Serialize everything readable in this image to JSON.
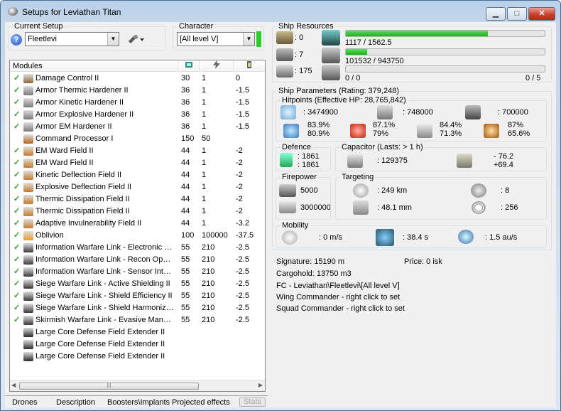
{
  "window": {
    "title": "Setups for Leviathan Titan",
    "controls": {
      "minimize": "▁",
      "maximize": "□",
      "close": "✕"
    }
  },
  "current_setup": {
    "label": "Current Setup",
    "value": "Fleetlevi",
    "help_icon": "?"
  },
  "character": {
    "label": "Character",
    "value": "[All level V]"
  },
  "modules": {
    "headers": {
      "name": "Modules",
      "col1_icon": "cpu-icon",
      "col2_icon": "powergrid-icon",
      "col3_icon": "capacitor-icon"
    },
    "rows": [
      {
        "checked": "✓",
        "name": "Damage Control II",
        "c1": "30",
        "c2": "1",
        "c3": "0",
        "icon_color": "#8a6a3a"
      },
      {
        "checked": "✓",
        "name": "Armor Thermic Hardener II",
        "c1": "36",
        "c2": "1",
        "c3": "-1.5",
        "icon_color": "#7a7a7a"
      },
      {
        "checked": "✓",
        "name": "Armor Kinetic Hardener II",
        "c1": "36",
        "c2": "1",
        "c3": "-1.5",
        "icon_color": "#7a7a7a"
      },
      {
        "checked": "✓",
        "name": "Armor Explosive Hardener II",
        "c1": "36",
        "c2": "1",
        "c3": "-1.5",
        "icon_color": "#7a7a7a"
      },
      {
        "checked": "✓",
        "name": "Armor EM Hardener II",
        "c1": "36",
        "c2": "1",
        "c3": "-1.5",
        "icon_color": "#7a7a7a"
      },
      {
        "checked": "",
        "name": "Command Processor I",
        "c1": "150",
        "c2": "50",
        "c3": "",
        "icon_color": "#b5651d"
      },
      {
        "checked": "✓",
        "name": "EM Ward Field II",
        "c1": "44",
        "c2": "1",
        "c3": "-2",
        "icon_color": "#c87a2a"
      },
      {
        "checked": "✓",
        "name": "EM Ward Field II",
        "c1": "44",
        "c2": "1",
        "c3": "-2",
        "icon_color": "#c87a2a"
      },
      {
        "checked": "✓",
        "name": "Kinetic Deflection Field II",
        "c1": "44",
        "c2": "1",
        "c3": "-2",
        "icon_color": "#c87a2a"
      },
      {
        "checked": "✓",
        "name": "Explosive Deflection Field II",
        "c1": "44",
        "c2": "1",
        "c3": "-2",
        "icon_color": "#c87a2a"
      },
      {
        "checked": "✓",
        "name": "Thermic Dissipation Field II",
        "c1": "44",
        "c2": "1",
        "c3": "-2",
        "icon_color": "#c87a2a"
      },
      {
        "checked": "✓",
        "name": "Thermic Dissipation Field II",
        "c1": "44",
        "c2": "1",
        "c3": "-2",
        "icon_color": "#c87a2a"
      },
      {
        "checked": "✓",
        "name": "Adaptive Invulnerability Field II",
        "c1": "44",
        "c2": "1",
        "c3": "-3.2",
        "icon_color": "#c87a2a"
      },
      {
        "checked": "✓",
        "name": "Oblivion",
        "c1": "100",
        "c2": "100000",
        "c3": "-37.5",
        "icon_color": "#e8a020"
      },
      {
        "checked": "✓",
        "name": "Information Warfare Link - Electronic S...",
        "c1": "55",
        "c2": "210",
        "c3": "-2.5",
        "icon_color": "#3a3a3a"
      },
      {
        "checked": "✓",
        "name": "Information Warfare Link - Recon Oper...",
        "c1": "55",
        "c2": "210",
        "c3": "-2.5",
        "icon_color": "#3a3a3a"
      },
      {
        "checked": "✓",
        "name": "Information Warfare Link - Sensor Integ...",
        "c1": "55",
        "c2": "210",
        "c3": "-2.5",
        "icon_color": "#3a3a3a"
      },
      {
        "checked": "✓",
        "name": "Siege Warfare Link - Active Shielding II",
        "c1": "55",
        "c2": "210",
        "c3": "-2.5",
        "icon_color": "#3a3a3a"
      },
      {
        "checked": "✓",
        "name": "Siege Warfare Link - Shield Efficiency II",
        "c1": "55",
        "c2": "210",
        "c3": "-2.5",
        "icon_color": "#3a3a3a"
      },
      {
        "checked": "✓",
        "name": "Siege Warfare Link - Shield Harmonizin...",
        "c1": "55",
        "c2": "210",
        "c3": "-2.5",
        "icon_color": "#3a3a3a"
      },
      {
        "checked": "✓",
        "name": "Skirmish Warfare Link - Evasive Maneu...",
        "c1": "55",
        "c2": "210",
        "c3": "-2.5",
        "icon_color": "#3a3a3a"
      },
      {
        "checked": "",
        "name": "Large Core Defense Field Extender II",
        "c1": "",
        "c2": "",
        "c3": "",
        "icon_color": "#2a2a2a"
      },
      {
        "checked": "",
        "name": "Large Core Defense Field Extender II",
        "c1": "",
        "c2": "",
        "c3": "",
        "icon_color": "#2a2a2a"
      },
      {
        "checked": "",
        "name": "Large Core Defense Field Extender II",
        "c1": "",
        "c2": "",
        "c3": "",
        "icon_color": "#2a2a2a"
      }
    ],
    "scrollbar": {
      "left_arrow": "◀",
      "right_arrow": "▶",
      "grip": "|||"
    }
  },
  "tabs": [
    "Drones",
    "Description",
    "Boosters\\Implants",
    "Projected effects",
    "Stats"
  ],
  "ship_resources": {
    "label": "Ship Resources",
    "turret_slots": ": 0",
    "launcher_slots": ": 7",
    "drone_bandwidth_label": ": 175",
    "cpu": {
      "text": "1117 / 1562.5",
      "fraction": 0.715
    },
    "powergrid": {
      "text": "101532 / 943750",
      "fraction": 0.108
    },
    "calibration": {
      "text_left": "0 / 0",
      "text_right": "0 / 5",
      "fraction": 0
    }
  },
  "ship_parameters": {
    "label": "Ship Parameters (Rating: 379,248)",
    "hitpoints": {
      "label": "Hitpoints (Effective HP: 28,765,842)",
      "shield": ": 3474900",
      "armor": ": 748000",
      "structure": ": 700000",
      "em": [
        "83.9%",
        "80.9%"
      ],
      "thermal": [
        "87.1%",
        "79%"
      ],
      "kinetic": [
        "84.4%",
        "71.3%"
      ],
      "explosive": [
        "87%",
        "65.6%"
      ]
    },
    "defence": {
      "label": "Defence",
      "line1": ": 1861",
      "line2": ": 1861"
    },
    "capacitor": {
      "label": "Capacitor (Lasts: > 1 h)",
      "amount": ": 129375",
      "delta1": "- 76.2",
      "delta2": "+69.4"
    },
    "firepower": {
      "label": "Firepower",
      "dps": "5000",
      "volley": "3000000"
    },
    "targeting": {
      "label": "Targeting",
      "range": ": 249 km",
      "targets": ": 8",
      "scan": ": 48.1 mm",
      "resolution": ": 256"
    },
    "mobility": {
      "label": "Mobility",
      "speed": ": 0 m/s",
      "align": ": 38.4 s",
      "warp": ": 1.5 au/s"
    }
  },
  "info": {
    "signature": "Signature: 15190 m",
    "price": "Price: 0 isk",
    "cargohold": "Cargohold: 13750 m3",
    "fc": "FC - Leviathan\\Fleetlevi\\[All level V]",
    "wing": "Wing Commander - right click to set",
    "squad": "Squad Commander - right click to set"
  },
  "colors": {
    "accent_green": "#26d026",
    "check_green": "#2e9e2e",
    "close_red": "#c8402a"
  }
}
